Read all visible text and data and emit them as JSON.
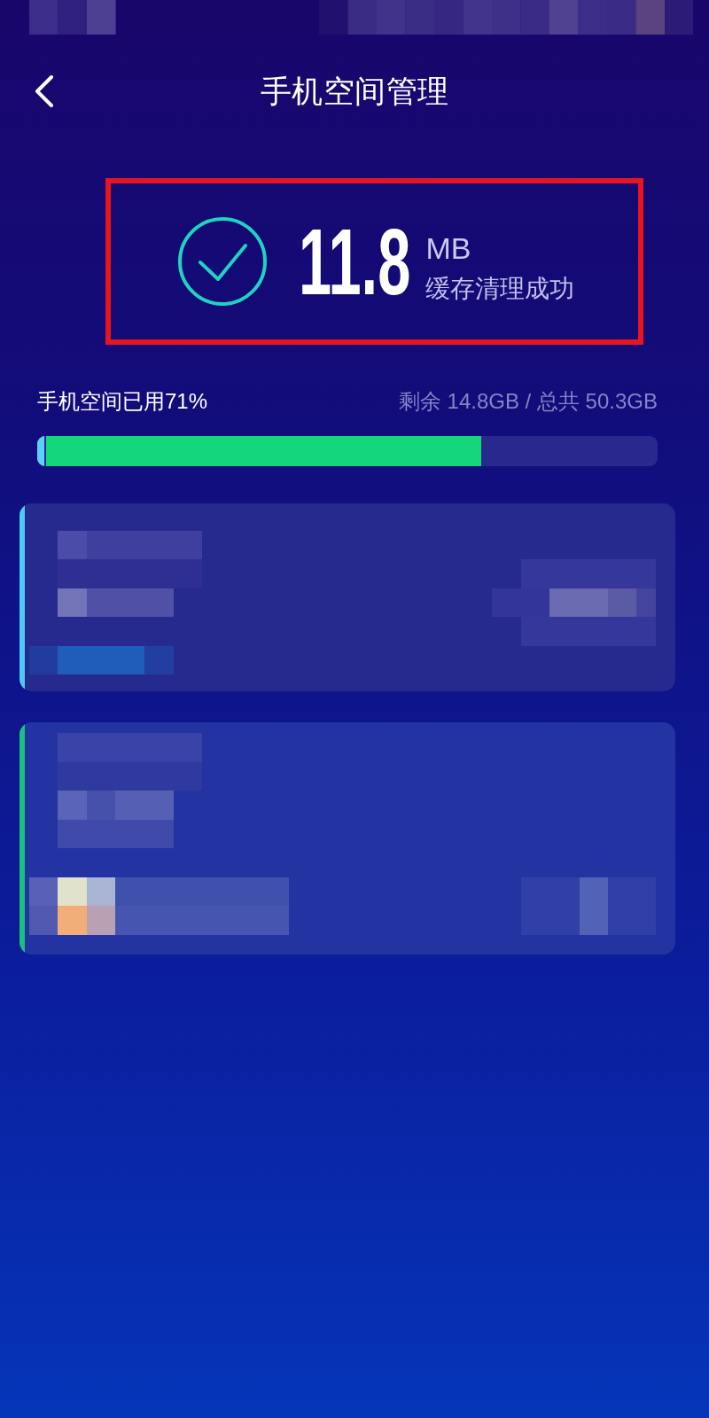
{
  "header": {
    "title": "手机空间管理"
  },
  "result": {
    "amount": "11.8",
    "unit": "MB",
    "message": "缓存清理成功",
    "highlighted": true
  },
  "storage": {
    "used_label": "手机空间已用71%",
    "summary": "剩余 14.8GB / 总共 50.3GB",
    "segments": [
      {
        "level": 0.014,
        "color": "#5ccfff"
      },
      {
        "level": 0.716,
        "color": "#14d77b"
      }
    ]
  },
  "cards": [
    {
      "color": "#4fc8f5"
    },
    {
      "color": "#1cc07e"
    }
  ]
}
